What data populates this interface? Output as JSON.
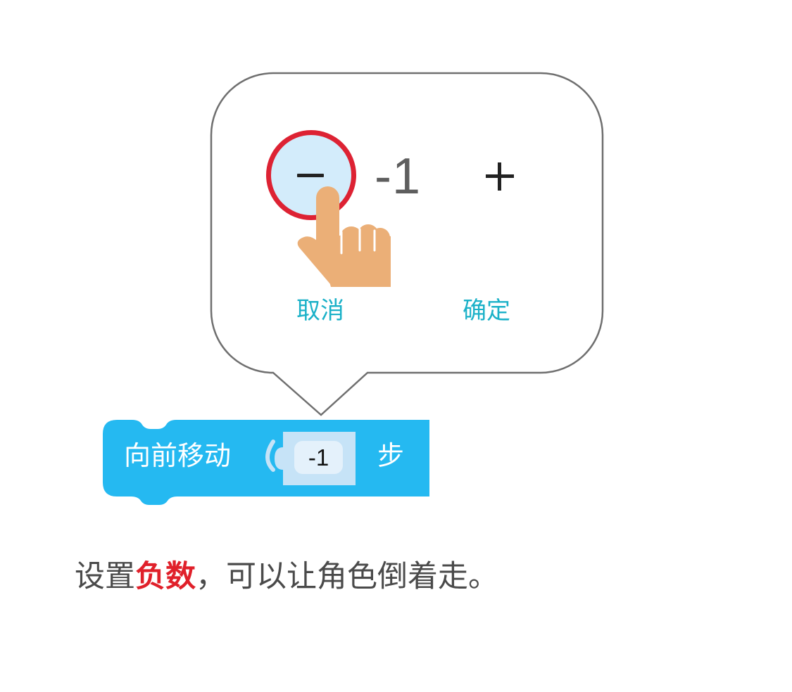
{
  "popup": {
    "value": "-1",
    "cancel_label": "取消",
    "confirm_label": "确定",
    "minus_icon": "minus-icon",
    "plus_icon": "plus-icon",
    "hand_icon": "pointing-hand-icon"
  },
  "block": {
    "label": "向前移动",
    "input_value": "-1",
    "unit": "步"
  },
  "caption": {
    "prefix": "设置",
    "highlight": "负数",
    "suffix": "，可以让角色倒着走。"
  },
  "colors": {
    "block_blue": "#25b9f1",
    "highlight_red": "#e0202a",
    "button_teal": "#1bb1c8",
    "ring_red": "#dd2233",
    "hand_skin": "#ebaf77"
  }
}
